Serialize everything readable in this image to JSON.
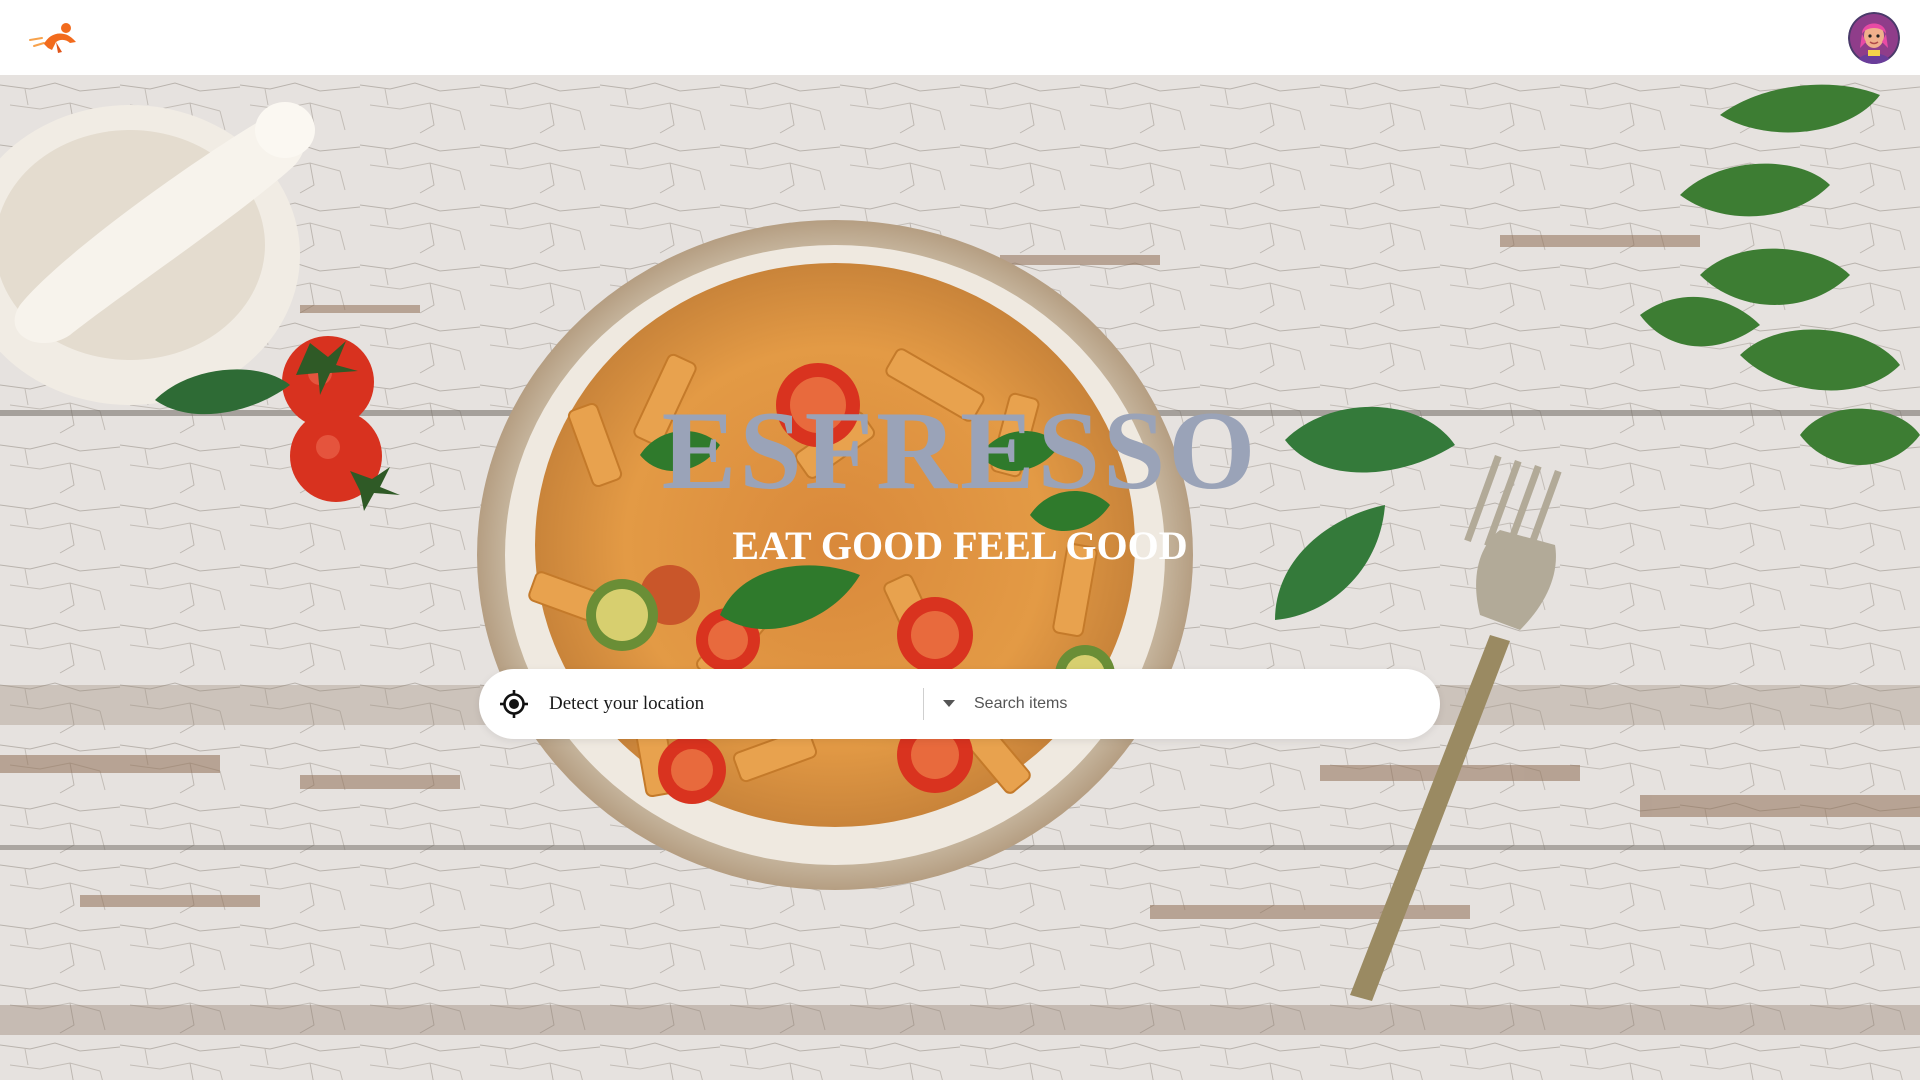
{
  "brand": {
    "name": "ESFRESSO",
    "tagline": "EAT GOOD FEEL GOOD",
    "title_color": "#9aa3b8",
    "logo_color": "#f26b1d"
  },
  "header": {
    "logo_icon": "flying-runner-logo-icon",
    "avatar_icon": "user-avatar-icon"
  },
  "search": {
    "location_label": "Detect your location",
    "location_icon": "crosshair-icon",
    "dropdown_icon": "caret-down-icon",
    "placeholder": "Search items"
  },
  "hero": {
    "background": "pasta bowl on cracked white wooden table"
  }
}
